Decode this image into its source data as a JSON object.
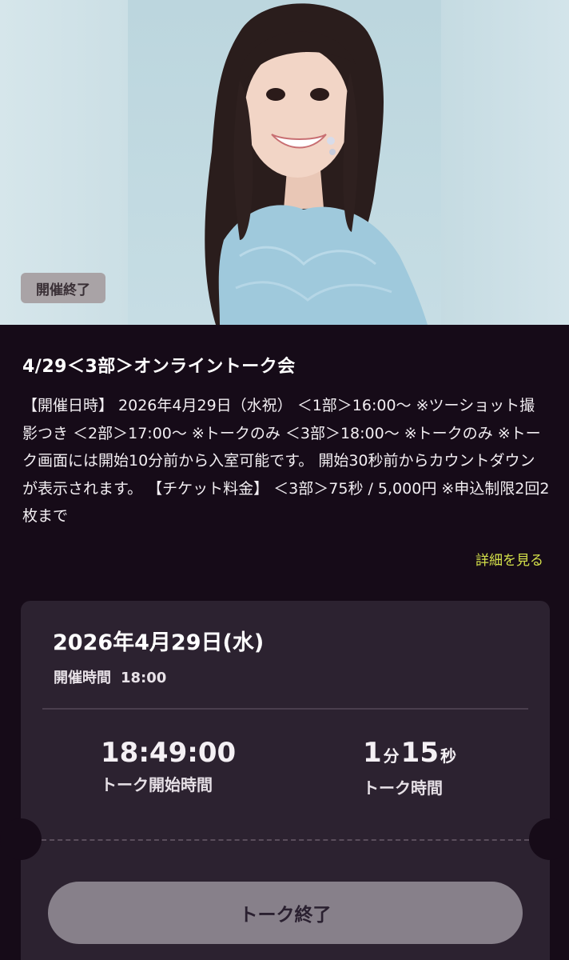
{
  "hero": {
    "status_badge": "開催終了"
  },
  "event": {
    "title": "4/29＜3部＞オンライントーク会",
    "description": "【開催日時】 2026年4月29日（水祝） ＜1部＞16:00～ ※ツーショット撮影つき ＜2部＞17:00～ ※トークのみ ＜3部＞18:00～ ※トークのみ ※トーク画面には開始10分前から入室可能です。 開始30秒前からカウントダウンが表示されます。 【チケット料金】 ＜3部＞75秒 / 5,000円 ※申込制限2回2枚まで",
    "details_link": "詳細を見る"
  },
  "ticket": {
    "date": "2026年4月29日(水)",
    "time_label": "開催時間",
    "time_value": "18:00",
    "start_time": "18:49:00",
    "start_label": "トーク開始時間",
    "duration_minutes": "1",
    "duration_min_unit": "分",
    "duration_seconds": "15",
    "duration_sec_unit": "秒",
    "duration_label": "トーク時間",
    "end_button": "トーク終了"
  },
  "colors": {
    "background": "#160b18",
    "card": "#2c2230",
    "accent_link": "#d4e14a",
    "button": "#87808a"
  }
}
